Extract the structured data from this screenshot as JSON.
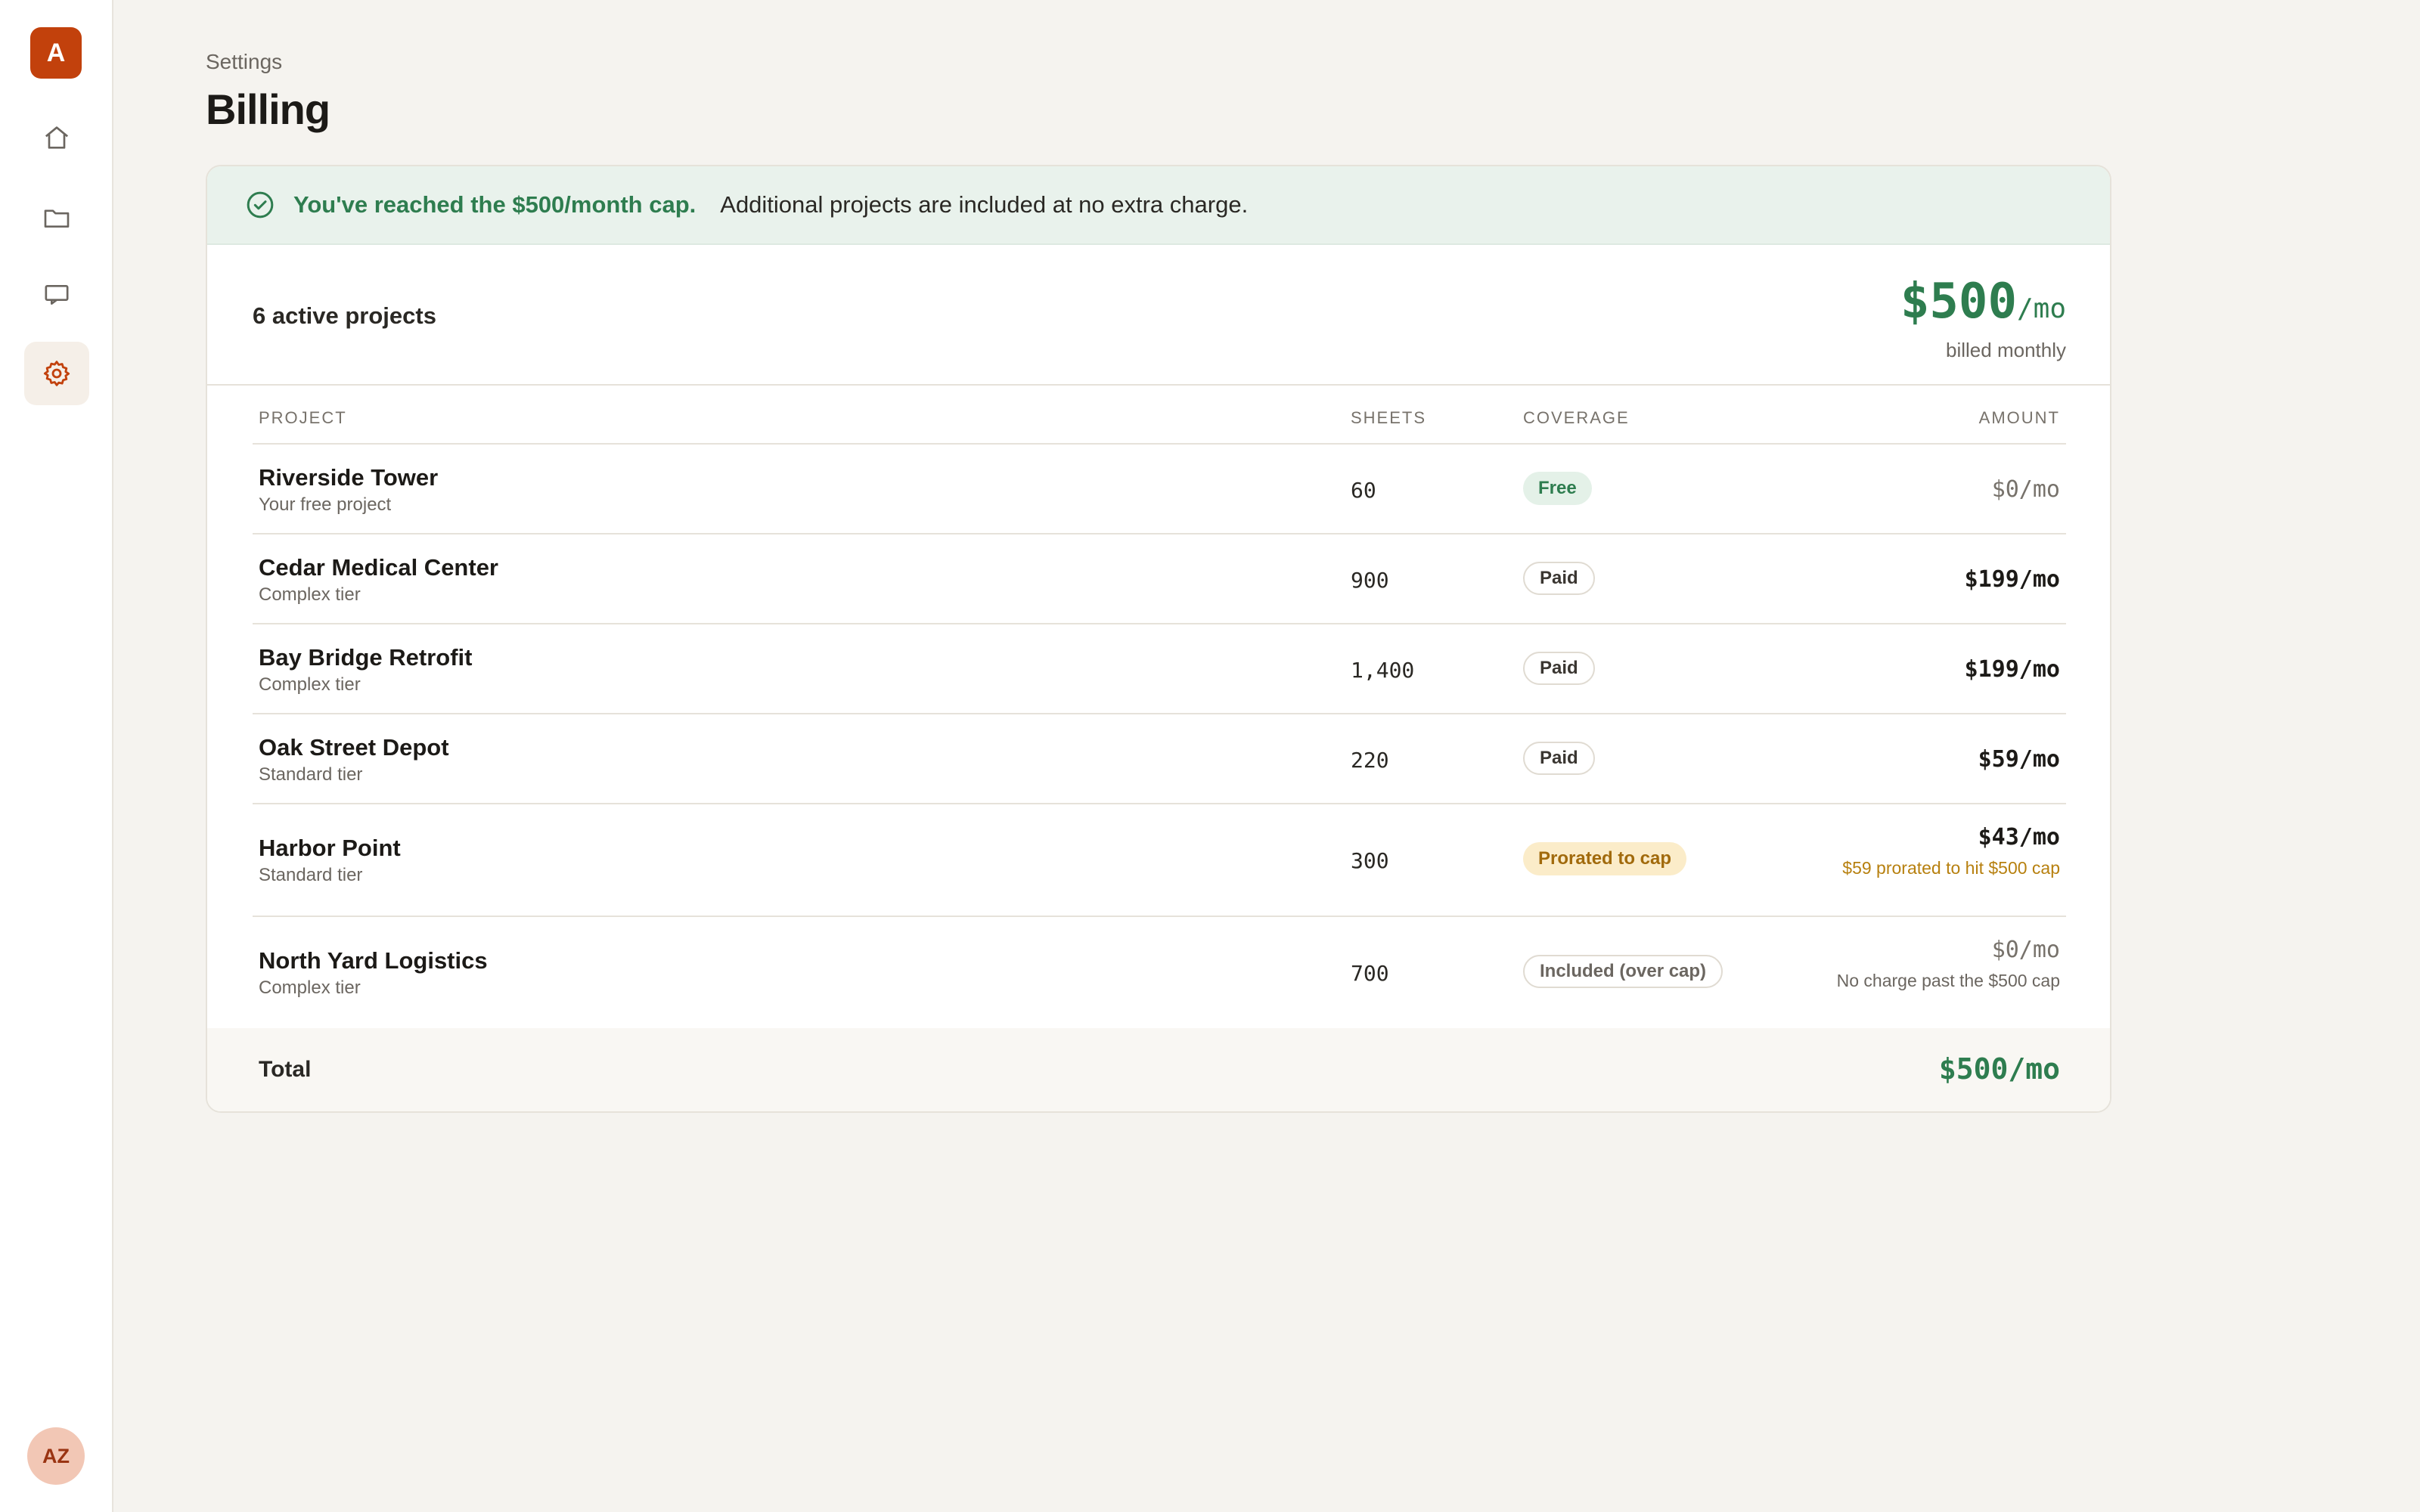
{
  "app": {
    "logo_letter": "A",
    "user_initials": "AZ",
    "brand_color": "#c2410c"
  },
  "sidebar": {
    "items": [
      {
        "name": "home",
        "icon": "home-icon",
        "active": false
      },
      {
        "name": "projects",
        "icon": "folder-icon",
        "active": false
      },
      {
        "name": "inbox",
        "icon": "inbox-icon",
        "active": false
      },
      {
        "name": "settings",
        "icon": "gear-icon",
        "active": true
      }
    ]
  },
  "header": {
    "breadcrumb": "Settings",
    "title": "Billing"
  },
  "banner": {
    "icon": "check-circle-icon",
    "strong": "You've reached the $500/month cap.",
    "rest": "Additional projects are included at no extra charge."
  },
  "summary": {
    "count": "6 active projects",
    "price": "$500",
    "unit": "/mo",
    "billing": "billed monthly"
  },
  "table": {
    "columns": [
      "PROJECT",
      "SHEETS",
      "COVERAGE",
      "AMOUNT"
    ],
    "rows": [
      {
        "name": "Riverside Tower",
        "sub": "Your free project",
        "sheets": "60",
        "coverage": "Free",
        "amount": "$0/mo",
        "note": ""
      },
      {
        "name": "Cedar Medical Center",
        "sub": "Complex tier",
        "sheets": "900",
        "coverage": "Paid",
        "amount": "$199/mo",
        "note": ""
      },
      {
        "name": "Bay Bridge Retrofit",
        "sub": "Complex tier",
        "sheets": "1,400",
        "coverage": "Paid",
        "amount": "$199/mo",
        "note": ""
      },
      {
        "name": "Oak Street Depot",
        "sub": "Standard tier",
        "sheets": "220",
        "coverage": "Paid",
        "amount": "$59/mo",
        "note": ""
      },
      {
        "name": "Harbor Point",
        "sub": "Standard tier",
        "sheets": "300",
        "coverage": "Prorated to cap",
        "amount": "$43/mo",
        "note": "$59 prorated to hit $500 cap"
      },
      {
        "name": "North Yard Logistics",
        "sub": "Complex tier",
        "sheets": "700",
        "coverage": "Included (over cap)",
        "amount": "$0/mo",
        "note": "No charge past the $500 cap"
      }
    ]
  },
  "total": {
    "label": "Total",
    "value": "$500/mo"
  }
}
